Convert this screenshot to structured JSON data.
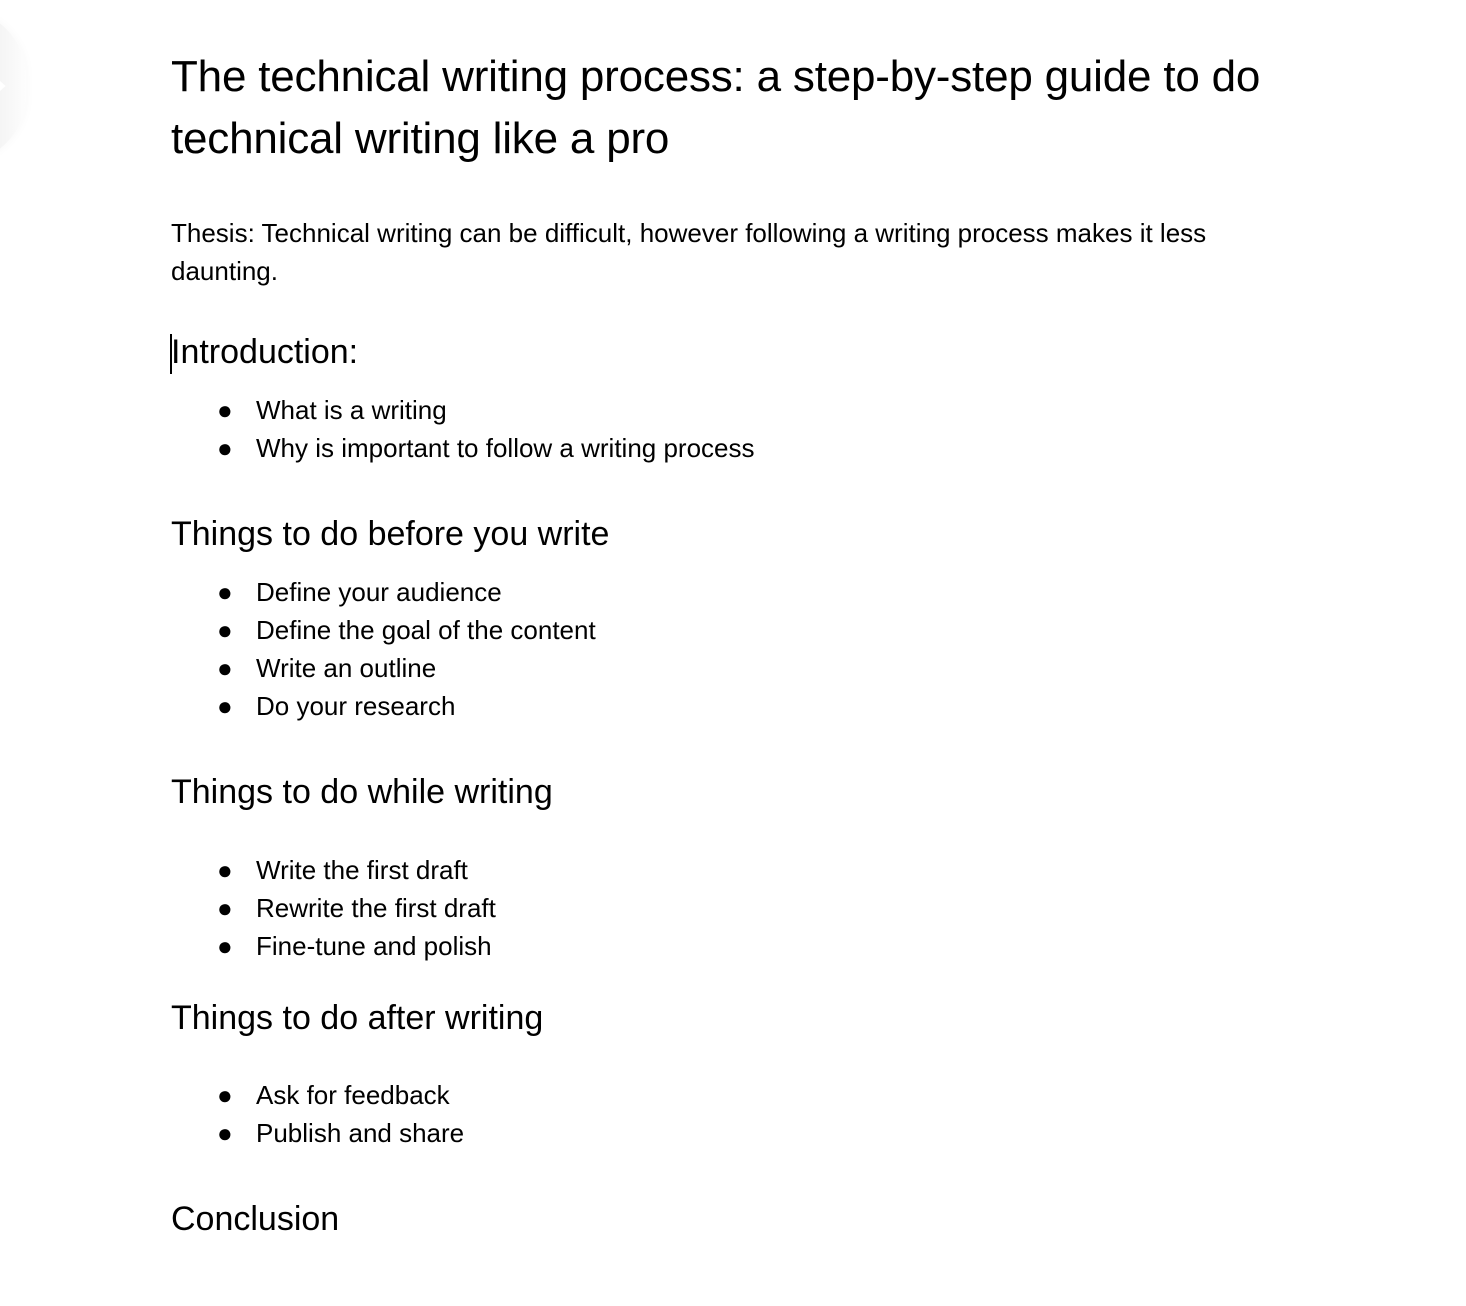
{
  "document": {
    "title": "The technical writing process: a step-by-step guide to do technical writing like a pro",
    "thesis": "Thesis: Technical writing can be difficult, however following a writing process makes it less daunting.",
    "bullet_glyph": "●",
    "caret_position": "before-introduction-heading",
    "sections": [
      {
        "heading": "Introduction:",
        "items": [
          "What is a writing",
          "Why is important to follow a writing process"
        ]
      },
      {
        "heading": "Things to do before you write",
        "items": [
          "Define your audience",
          "Define the goal of the content",
          "Write an outline",
          "Do your research"
        ]
      },
      {
        "heading": "Things to do while writing",
        "items": [
          "Write the first draft",
          "Rewrite the first draft",
          "Fine-tune and polish"
        ]
      },
      {
        "heading": "Things to do after writing",
        "items": [
          "Ask for feedback",
          "Publish and share"
        ]
      },
      {
        "heading": "Conclusion",
        "items": []
      }
    ]
  },
  "outline_panel": {
    "toggle_icon": "chevron-right-icon"
  },
  "colors": {
    "text": "#000000",
    "page_background": "#ffffff",
    "handle_background": "#f1f1f1",
    "caret": "#000000"
  }
}
